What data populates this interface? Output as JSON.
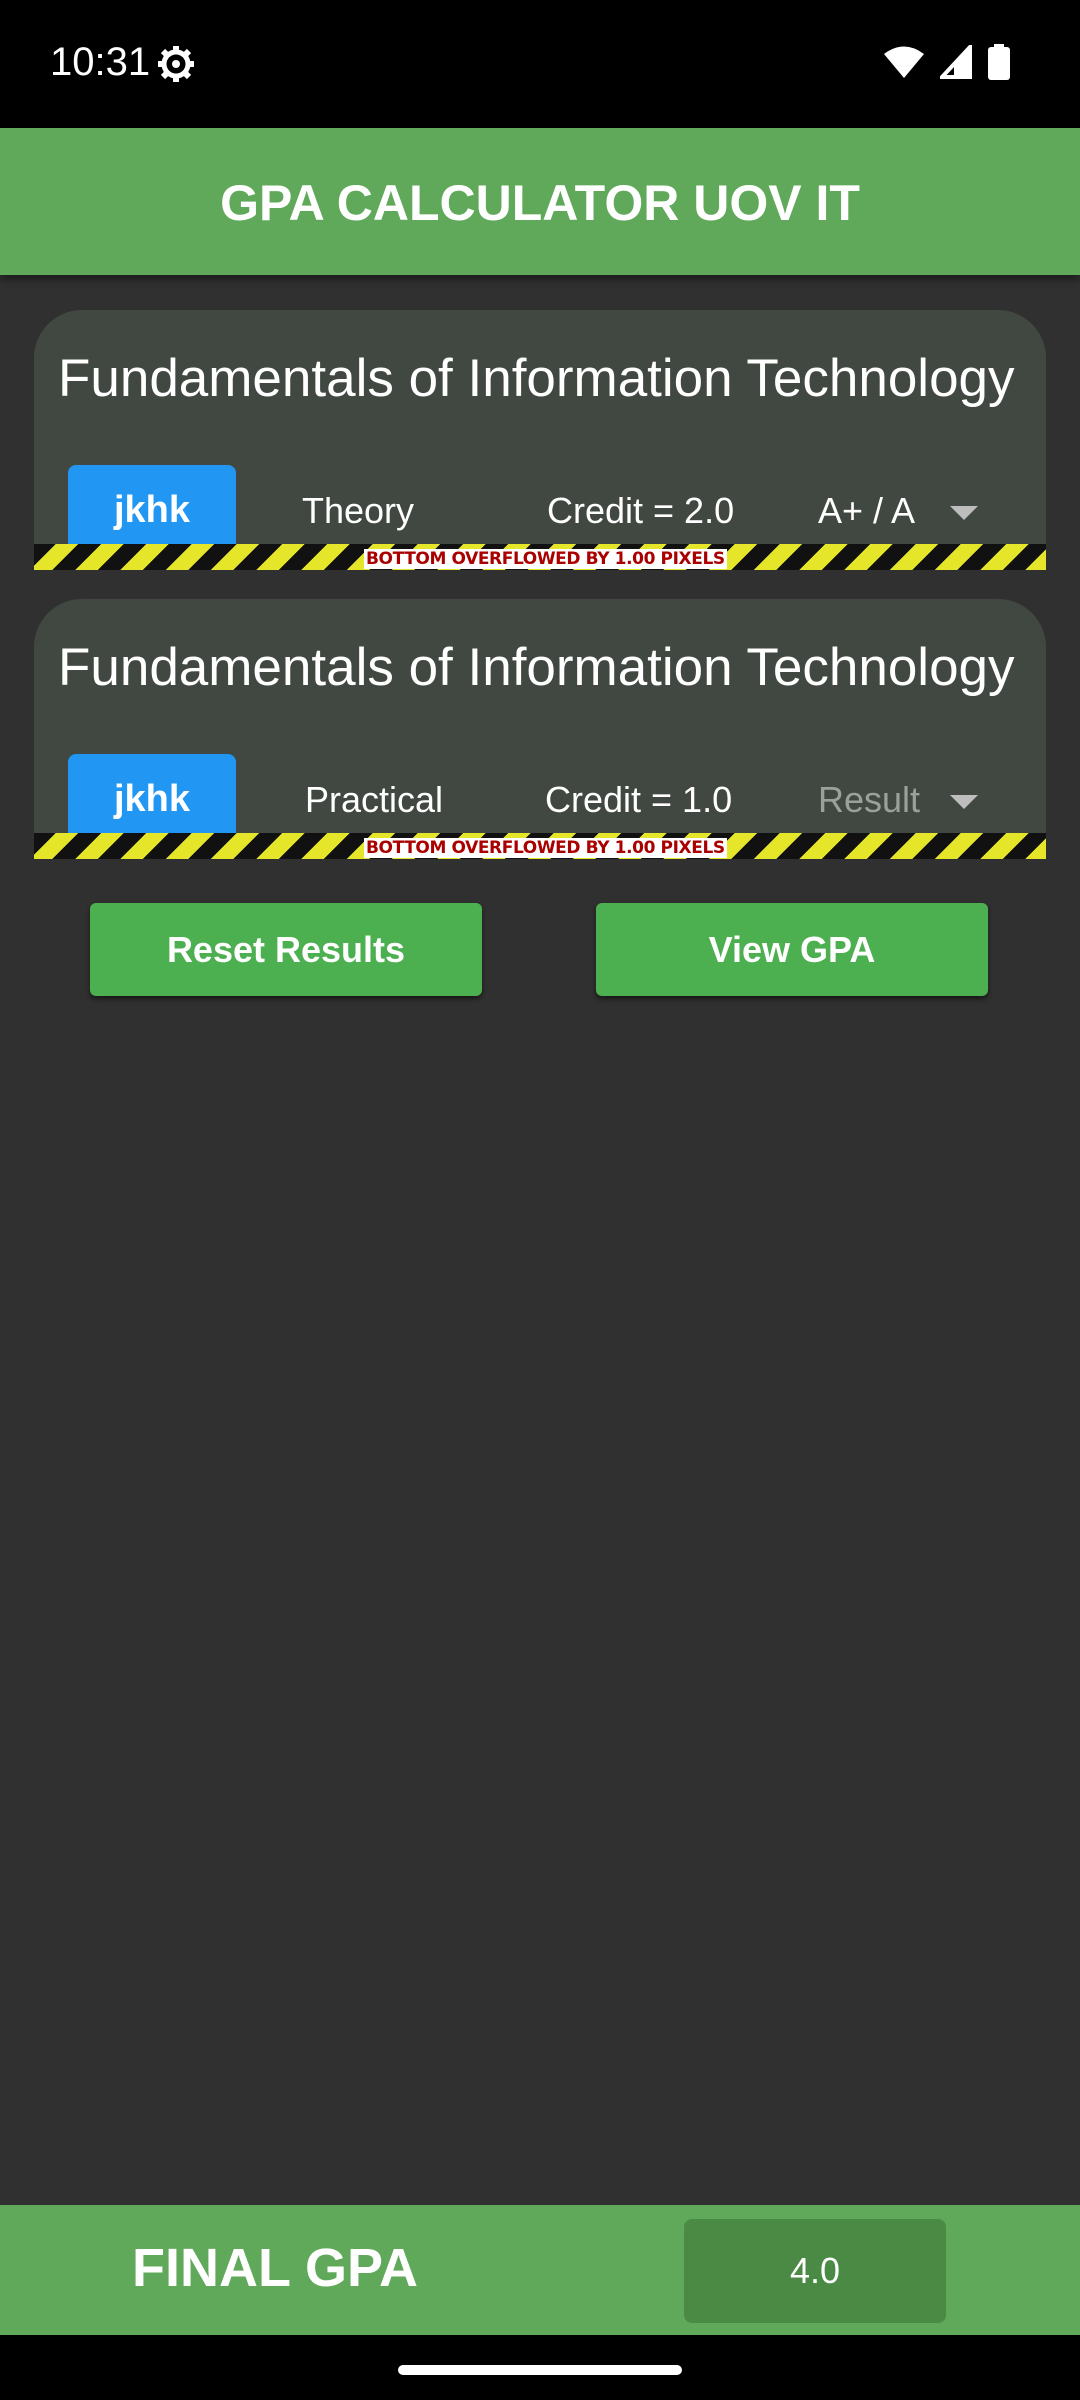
{
  "status_bar": {
    "time": "10:31",
    "icons": [
      "settings-gear-icon",
      "wifi-icon",
      "cellular-signal-icon",
      "battery-icon"
    ]
  },
  "app_bar": {
    "title": "GPA CALCULATOR UOV IT"
  },
  "courses": [
    {
      "title": "Fundamentals of Information Technology",
      "code": "jkhk",
      "type": "Theory",
      "credit": "Credit = 2.0",
      "grade": "A+ / A",
      "overflow_warning": "BOTTOM OVERFLOWED BY 1.00 PIXELS"
    },
    {
      "title": "Fundamentals of Information Technology",
      "code": "jkhk",
      "type": "Practical",
      "credit": "Credit = 1.0",
      "grade_placeholder": "Result",
      "overflow_warning": "BOTTOM OVERFLOWED BY 1.00 PIXELS"
    }
  ],
  "buttons": {
    "reset": "Reset Results",
    "view": "View GPA"
  },
  "footer": {
    "label": "FINAL GPA",
    "value": "4.0"
  },
  "colors": {
    "app_bar": "#60a95a",
    "background": "#303030",
    "card": "#414841",
    "chip": "#2196f3",
    "button": "#4caf50",
    "gpa_box": "#4a8a45"
  }
}
